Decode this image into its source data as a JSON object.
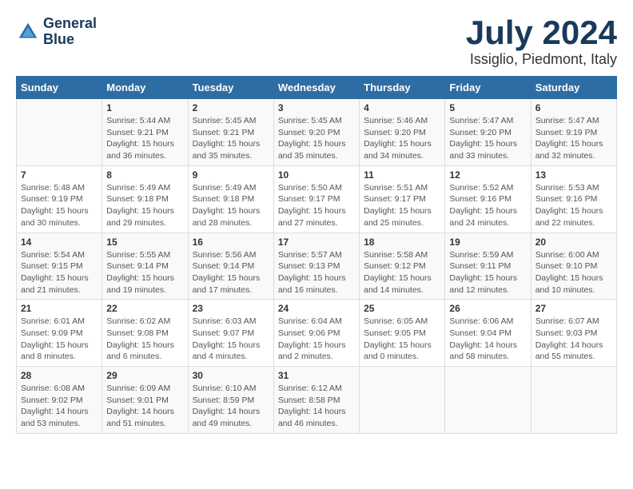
{
  "header": {
    "logo_line1": "General",
    "logo_line2": "Blue",
    "month": "July 2024",
    "location": "Issiglio, Piedmont, Italy"
  },
  "weekdays": [
    "Sunday",
    "Monday",
    "Tuesday",
    "Wednesday",
    "Thursday",
    "Friday",
    "Saturday"
  ],
  "weeks": [
    [
      {
        "day": "",
        "info": ""
      },
      {
        "day": "1",
        "info": "Sunrise: 5:44 AM\nSunset: 9:21 PM\nDaylight: 15 hours\nand 36 minutes."
      },
      {
        "day": "2",
        "info": "Sunrise: 5:45 AM\nSunset: 9:21 PM\nDaylight: 15 hours\nand 35 minutes."
      },
      {
        "day": "3",
        "info": "Sunrise: 5:45 AM\nSunset: 9:20 PM\nDaylight: 15 hours\nand 35 minutes."
      },
      {
        "day": "4",
        "info": "Sunrise: 5:46 AM\nSunset: 9:20 PM\nDaylight: 15 hours\nand 34 minutes."
      },
      {
        "day": "5",
        "info": "Sunrise: 5:47 AM\nSunset: 9:20 PM\nDaylight: 15 hours\nand 33 minutes."
      },
      {
        "day": "6",
        "info": "Sunrise: 5:47 AM\nSunset: 9:19 PM\nDaylight: 15 hours\nand 32 minutes."
      }
    ],
    [
      {
        "day": "7",
        "info": "Sunrise: 5:48 AM\nSunset: 9:19 PM\nDaylight: 15 hours\nand 30 minutes."
      },
      {
        "day": "8",
        "info": "Sunrise: 5:49 AM\nSunset: 9:18 PM\nDaylight: 15 hours\nand 29 minutes."
      },
      {
        "day": "9",
        "info": "Sunrise: 5:49 AM\nSunset: 9:18 PM\nDaylight: 15 hours\nand 28 minutes."
      },
      {
        "day": "10",
        "info": "Sunrise: 5:50 AM\nSunset: 9:17 PM\nDaylight: 15 hours\nand 27 minutes."
      },
      {
        "day": "11",
        "info": "Sunrise: 5:51 AM\nSunset: 9:17 PM\nDaylight: 15 hours\nand 25 minutes."
      },
      {
        "day": "12",
        "info": "Sunrise: 5:52 AM\nSunset: 9:16 PM\nDaylight: 15 hours\nand 24 minutes."
      },
      {
        "day": "13",
        "info": "Sunrise: 5:53 AM\nSunset: 9:16 PM\nDaylight: 15 hours\nand 22 minutes."
      }
    ],
    [
      {
        "day": "14",
        "info": "Sunrise: 5:54 AM\nSunset: 9:15 PM\nDaylight: 15 hours\nand 21 minutes."
      },
      {
        "day": "15",
        "info": "Sunrise: 5:55 AM\nSunset: 9:14 PM\nDaylight: 15 hours\nand 19 minutes."
      },
      {
        "day": "16",
        "info": "Sunrise: 5:56 AM\nSunset: 9:14 PM\nDaylight: 15 hours\nand 17 minutes."
      },
      {
        "day": "17",
        "info": "Sunrise: 5:57 AM\nSunset: 9:13 PM\nDaylight: 15 hours\nand 16 minutes."
      },
      {
        "day": "18",
        "info": "Sunrise: 5:58 AM\nSunset: 9:12 PM\nDaylight: 15 hours\nand 14 minutes."
      },
      {
        "day": "19",
        "info": "Sunrise: 5:59 AM\nSunset: 9:11 PM\nDaylight: 15 hours\nand 12 minutes."
      },
      {
        "day": "20",
        "info": "Sunrise: 6:00 AM\nSunset: 9:10 PM\nDaylight: 15 hours\nand 10 minutes."
      }
    ],
    [
      {
        "day": "21",
        "info": "Sunrise: 6:01 AM\nSunset: 9:09 PM\nDaylight: 15 hours\nand 8 minutes."
      },
      {
        "day": "22",
        "info": "Sunrise: 6:02 AM\nSunset: 9:08 PM\nDaylight: 15 hours\nand 6 minutes."
      },
      {
        "day": "23",
        "info": "Sunrise: 6:03 AM\nSunset: 9:07 PM\nDaylight: 15 hours\nand 4 minutes."
      },
      {
        "day": "24",
        "info": "Sunrise: 6:04 AM\nSunset: 9:06 PM\nDaylight: 15 hours\nand 2 minutes."
      },
      {
        "day": "25",
        "info": "Sunrise: 6:05 AM\nSunset: 9:05 PM\nDaylight: 15 hours\nand 0 minutes."
      },
      {
        "day": "26",
        "info": "Sunrise: 6:06 AM\nSunset: 9:04 PM\nDaylight: 14 hours\nand 58 minutes."
      },
      {
        "day": "27",
        "info": "Sunrise: 6:07 AM\nSunset: 9:03 PM\nDaylight: 14 hours\nand 55 minutes."
      }
    ],
    [
      {
        "day": "28",
        "info": "Sunrise: 6:08 AM\nSunset: 9:02 PM\nDaylight: 14 hours\nand 53 minutes."
      },
      {
        "day": "29",
        "info": "Sunrise: 6:09 AM\nSunset: 9:01 PM\nDaylight: 14 hours\nand 51 minutes."
      },
      {
        "day": "30",
        "info": "Sunrise: 6:10 AM\nSunset: 8:59 PM\nDaylight: 14 hours\nand 49 minutes."
      },
      {
        "day": "31",
        "info": "Sunrise: 6:12 AM\nSunset: 8:58 PM\nDaylight: 14 hours\nand 46 minutes."
      },
      {
        "day": "",
        "info": ""
      },
      {
        "day": "",
        "info": ""
      },
      {
        "day": "",
        "info": ""
      }
    ]
  ]
}
